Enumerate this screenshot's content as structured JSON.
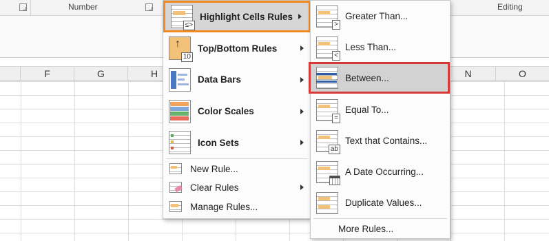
{
  "ribbon": {
    "number_label": "Number",
    "editing_label": "Editing"
  },
  "columns": [
    "F",
    "G",
    "H",
    "N",
    "O"
  ],
  "menu_main": {
    "items": [
      {
        "label": "Highlight Cells Rules",
        "icon": "highlight-cells-icon"
      },
      {
        "label": "Top/Bottom Rules",
        "icon": "top-bottom-icon",
        "badge": "10"
      },
      {
        "label": "Data Bars",
        "icon": "data-bars-icon"
      },
      {
        "label": "Color Scales",
        "icon": "color-scales-icon"
      },
      {
        "label": "Icon Sets",
        "icon": "icon-sets-icon"
      },
      {
        "label": "New Rule...",
        "icon": "new-rule-icon"
      },
      {
        "label": "Clear Rules",
        "icon": "clear-rules-icon"
      },
      {
        "label": "Manage Rules...",
        "icon": "manage-rules-icon"
      }
    ]
  },
  "menu_sub": {
    "items": [
      {
        "label": "Greater Than...",
        "icon": "greater-than-icon",
        "badge": ">"
      },
      {
        "label": "Less Than...",
        "icon": "less-than-icon",
        "badge": "<"
      },
      {
        "label": "Between...",
        "icon": "between-icon"
      },
      {
        "label": "Equal To...",
        "icon": "equal-to-icon",
        "badge": "="
      },
      {
        "label": "Text that Contains...",
        "icon": "text-contains-icon",
        "badge": "ab"
      },
      {
        "label": "A Date Occurring...",
        "icon": "date-occurring-icon"
      },
      {
        "label": "Duplicate Values...",
        "icon": "duplicate-values-icon"
      },
      {
        "label": "More Rules...",
        "icon": ""
      }
    ]
  },
  "colors": {
    "highlight_orange": "#f08a24",
    "highlight_red": "#d63a3a",
    "accent_bar": "#f2c27a"
  }
}
